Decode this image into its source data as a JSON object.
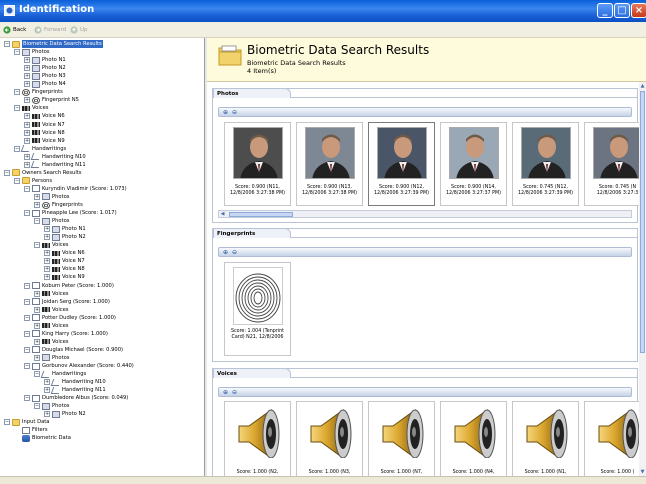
{
  "window": {
    "title": "Identification"
  },
  "toolbar": {
    "back": "Back",
    "forward": "Forward",
    "up": "Up"
  },
  "tree": [
    {
      "label": "Biometric Data Search Results",
      "level": 0,
      "icon": "folder",
      "exp": "-",
      "selected": true
    },
    {
      "label": "Photos",
      "level": 1,
      "icon": "photo",
      "exp": "-"
    },
    {
      "label": "Photo N1",
      "level": 2,
      "icon": "photo",
      "exp": "+"
    },
    {
      "label": "Photo N2",
      "level": 2,
      "icon": "photo",
      "exp": "+"
    },
    {
      "label": "Photo N3",
      "level": 2,
      "icon": "photo",
      "exp": "+"
    },
    {
      "label": "Photo N4",
      "level": 2,
      "icon": "photo",
      "exp": "+"
    },
    {
      "label": "Fingerprints",
      "level": 1,
      "icon": "finger",
      "exp": "-"
    },
    {
      "label": "Fingerprint N5",
      "level": 2,
      "icon": "finger",
      "exp": "+"
    },
    {
      "label": "Voices",
      "level": 1,
      "icon": "voice",
      "exp": "-"
    },
    {
      "label": "Voice N6",
      "level": 2,
      "icon": "voice",
      "exp": "+"
    },
    {
      "label": "Voice N7",
      "level": 2,
      "icon": "voice",
      "exp": "+"
    },
    {
      "label": "Voice N8",
      "level": 2,
      "icon": "voice",
      "exp": "+"
    },
    {
      "label": "Voice N9",
      "level": 2,
      "icon": "voice",
      "exp": "+"
    },
    {
      "label": "Handwritings",
      "level": 1,
      "icon": "hand",
      "exp": "-"
    },
    {
      "label": "Handwriting N10",
      "level": 2,
      "icon": "hand",
      "exp": "+"
    },
    {
      "label": "Handwriting N11",
      "level": 2,
      "icon": "hand",
      "exp": "+"
    },
    {
      "label": "Owners Search Results",
      "level": 0,
      "icon": "folder",
      "exp": "-"
    },
    {
      "label": "Persons",
      "level": 1,
      "icon": "folder",
      "exp": "-"
    },
    {
      "label": "Kuryndin Vladimir (Score: 1.073)",
      "level": 2,
      "icon": "doc",
      "exp": "-"
    },
    {
      "label": "Photos",
      "level": 3,
      "icon": "photo",
      "exp": "+"
    },
    {
      "label": "Fingerprints",
      "level": 3,
      "icon": "finger",
      "exp": "+"
    },
    {
      "label": "Pineapple Lee (Score: 1.017)",
      "level": 2,
      "icon": "doc",
      "exp": "-"
    },
    {
      "label": "Photos",
      "level": 3,
      "icon": "photo",
      "exp": "-"
    },
    {
      "label": "Photo N1",
      "level": 4,
      "icon": "photo",
      "exp": "+"
    },
    {
      "label": "Photo N2",
      "level": 4,
      "icon": "photo",
      "exp": "+"
    },
    {
      "label": "Voices",
      "level": 3,
      "icon": "voice",
      "exp": "-"
    },
    {
      "label": "Voice N6",
      "level": 4,
      "icon": "voice",
      "exp": "+"
    },
    {
      "label": "Voice N7",
      "level": 4,
      "icon": "voice",
      "exp": "+"
    },
    {
      "label": "Voice N8",
      "level": 4,
      "icon": "voice",
      "exp": "+"
    },
    {
      "label": "Voice N9",
      "level": 4,
      "icon": "voice",
      "exp": "+"
    },
    {
      "label": "Koburn Peter (Score: 1.000)",
      "level": 2,
      "icon": "doc",
      "exp": "-"
    },
    {
      "label": "Voices",
      "level": 3,
      "icon": "voice",
      "exp": "+"
    },
    {
      "label": "Joidan Serg (Score: 1.000)",
      "level": 2,
      "icon": "doc",
      "exp": "-"
    },
    {
      "label": "Voices",
      "level": 3,
      "icon": "voice",
      "exp": "+"
    },
    {
      "label": "Potter Dudley (Score: 1.000)",
      "level": 2,
      "icon": "doc",
      "exp": "-"
    },
    {
      "label": "Voices",
      "level": 3,
      "icon": "voice",
      "exp": "+"
    },
    {
      "label": "King Harry (Score: 1.000)",
      "level": 2,
      "icon": "doc",
      "exp": "-"
    },
    {
      "label": "Voices",
      "level": 3,
      "icon": "voice",
      "exp": "+"
    },
    {
      "label": "Douglas Michael (Score: 0.900)",
      "level": 2,
      "icon": "doc",
      "exp": "-"
    },
    {
      "label": "Photos",
      "level": 3,
      "icon": "photo",
      "exp": "+"
    },
    {
      "label": "Gorbunov Alexander (Score: 0.440)",
      "level": 2,
      "icon": "doc",
      "exp": "-"
    },
    {
      "label": "Handwritings",
      "level": 3,
      "icon": "hand",
      "exp": "-"
    },
    {
      "label": "Handwriting N10",
      "level": 4,
      "icon": "hand",
      "exp": "+"
    },
    {
      "label": "Handwriting N11",
      "level": 4,
      "icon": "hand",
      "exp": "+"
    },
    {
      "label": "Dumbledore Albus (Score: 0.049)",
      "level": 2,
      "icon": "doc",
      "exp": "-"
    },
    {
      "label": "Photos",
      "level": 3,
      "icon": "photo",
      "exp": "-"
    },
    {
      "label": "Photo N2",
      "level": 4,
      "icon": "photo",
      "exp": "+"
    },
    {
      "label": "Input Data",
      "level": 0,
      "icon": "folder",
      "exp": "-"
    },
    {
      "label": "Filters",
      "level": 1,
      "icon": "doc",
      "exp": ""
    },
    {
      "label": "Biometric Data",
      "level": 1,
      "icon": "db",
      "exp": ""
    }
  ],
  "header": {
    "title": "Biometric Data Search Results",
    "subtitle": "Biometric Data Search Results",
    "count": "4 Item(s)"
  },
  "photos_section": {
    "label": "Photos",
    "items": [
      {
        "score": "Score: 0.900 (N11,",
        "date": "12/8/2006 3:27:38 PM)"
      },
      {
        "score": "Score: 0.900 (N13,",
        "date": "12/8/2006 3:27:38 PM)"
      },
      {
        "score": "Score: 0.900 (N12,",
        "date": "12/8/2006 3:27:39 PM)"
      },
      {
        "score": "Score: 0.900 (N14,",
        "date": "12/8/2006 3:27:37 PM)"
      },
      {
        "score": "Score: 0.745 (N12,",
        "date": "12/8/2006 3:27:39 PM)"
      },
      {
        "score": "Score: 0.745 (N",
        "date": "12/8/2006 3:27:3"
      }
    ]
  },
  "fingerprints_section": {
    "label": "Fingerprints",
    "items": [
      {
        "score": "Score: 1.004 (Tenprint",
        "date": "Card) N21, 12/8/2006"
      }
    ]
  },
  "voices_section": {
    "label": "Voices",
    "items": [
      {
        "score": "Score: 1.000 (N2,"
      },
      {
        "score": "Score: 1.000 (N3,"
      },
      {
        "score": "Score: 1.000 (N7,"
      },
      {
        "score": "Score: 1.000 (N4,"
      },
      {
        "score": "Score: 1.000 (N1,"
      },
      {
        "score": "Score: 1.000 ("
      }
    ]
  },
  "colors": {
    "titlebar": "#0a5fd8",
    "selection": "#316ac5",
    "header_bg": "#fefbdc"
  }
}
